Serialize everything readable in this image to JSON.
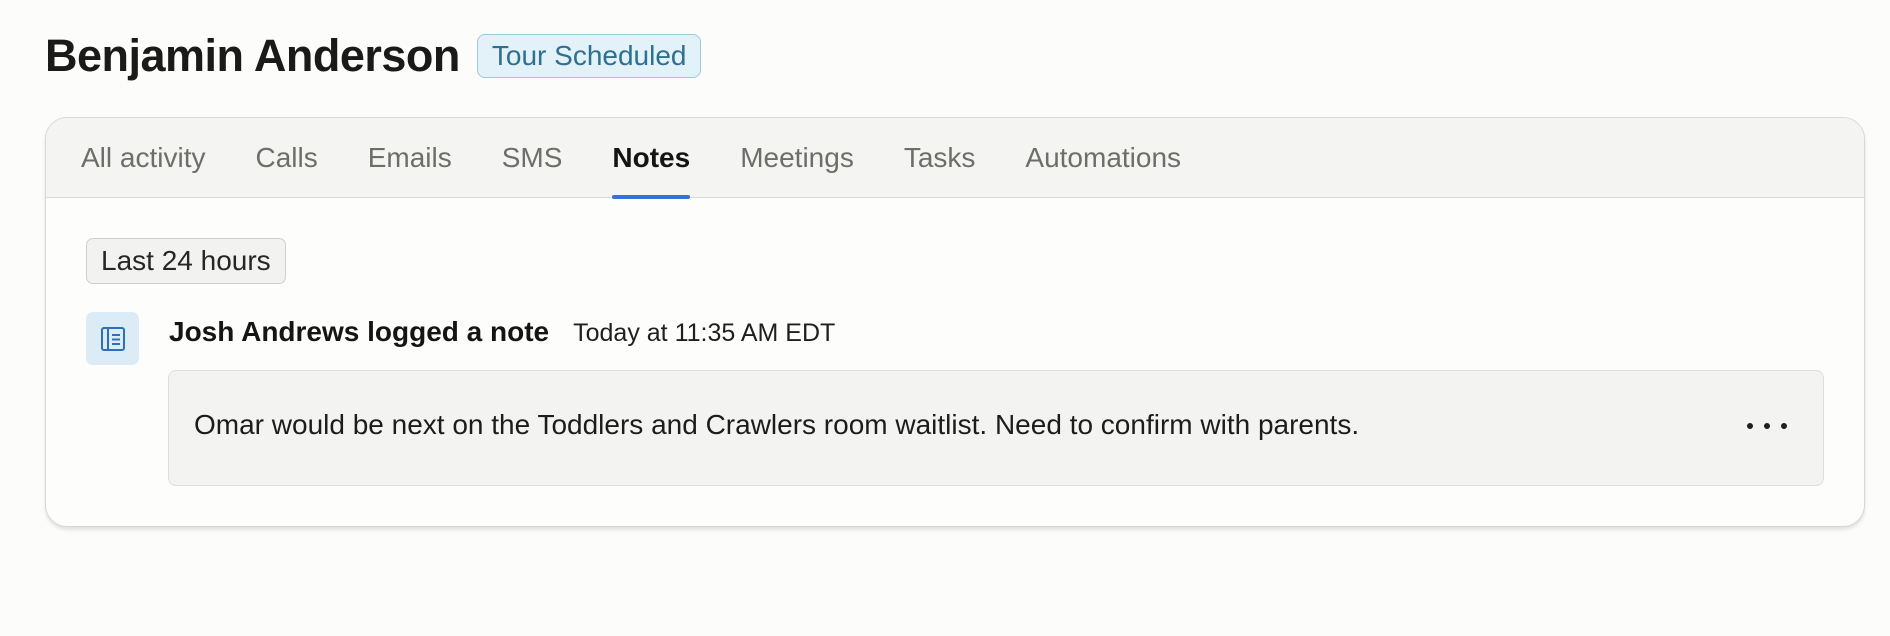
{
  "contact": {
    "name": "Benjamin Anderson",
    "status": "Tour Scheduled"
  },
  "tabs": [
    {
      "label": "All activity",
      "active": false
    },
    {
      "label": "Calls",
      "active": false
    },
    {
      "label": "Emails",
      "active": false
    },
    {
      "label": "SMS",
      "active": false
    },
    {
      "label": "Notes",
      "active": true
    },
    {
      "label": "Meetings",
      "active": false
    },
    {
      "label": "Tasks",
      "active": false
    },
    {
      "label": "Automations",
      "active": false
    }
  ],
  "filter": {
    "label": "Last 24 hours"
  },
  "note": {
    "icon": "note-document-icon",
    "author_line": "Josh Andrews logged a note",
    "timestamp": "Today at 11:35 AM EDT",
    "text": "Omar would be next on the Toddlers and Crawlers room waitlist. Need to confirm with parents.",
    "more_icon": "more-horizontal-icon"
  },
  "colors": {
    "accent": "#3b6fd8",
    "badge_bg": "#e3f1f8",
    "badge_text": "#2f6f8f",
    "icon_bg": "#dcecf7"
  }
}
